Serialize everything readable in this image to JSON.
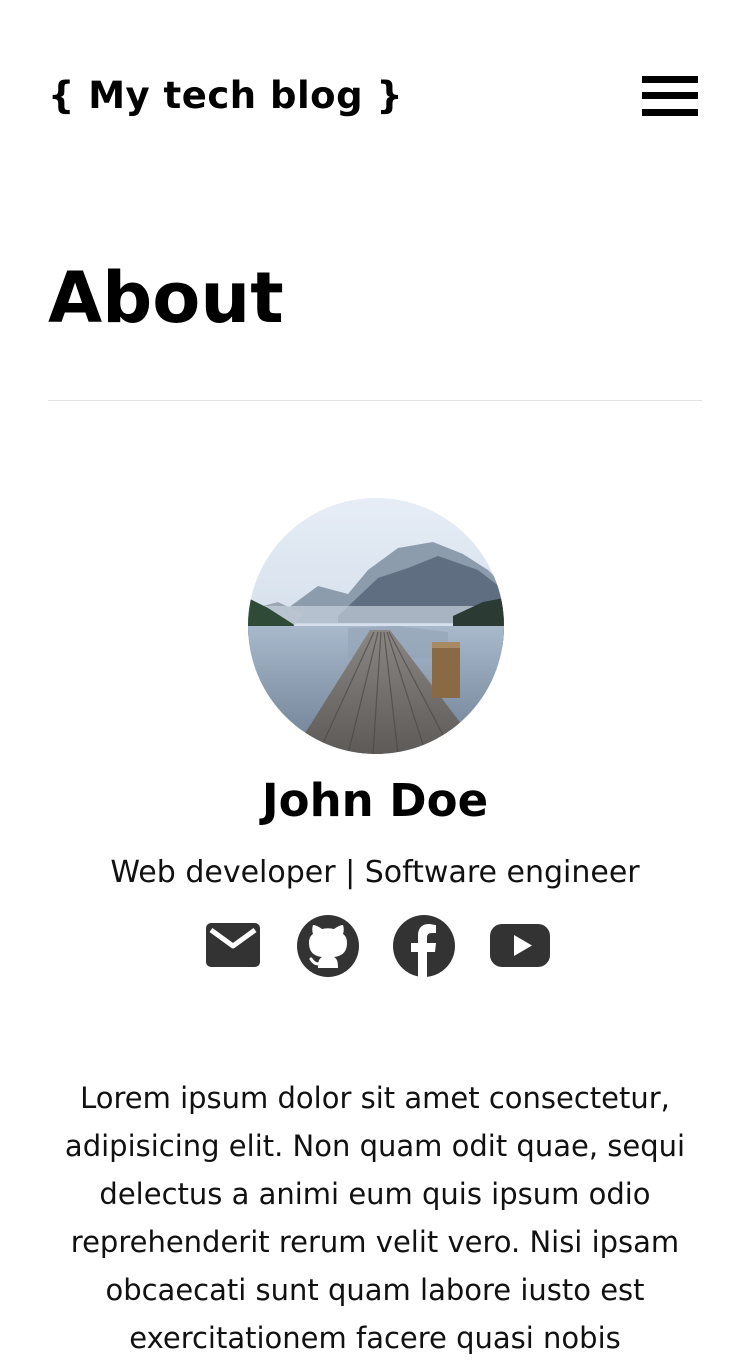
{
  "header": {
    "site_title": "{ My tech blog }",
    "menu_icon": "hamburger-menu-icon"
  },
  "page": {
    "title": "About"
  },
  "profile": {
    "avatar_alt": "Wooden pier on a mountain lake",
    "name": "John Doe",
    "role": "Web developer | Software engineer",
    "social": [
      {
        "icon": "mail-icon"
      },
      {
        "icon": "github-icon"
      },
      {
        "icon": "facebook-icon"
      },
      {
        "icon": "youtube-icon"
      }
    ],
    "icon_color": "#333333"
  },
  "bio": {
    "text": "Lorem ipsum dolor sit amet consectetur, adipisicing elit. Non quam odit quae, sequi delectus a animi eum quis ipsum odio reprehenderit rerum velit vero. Nisi ipsam obcaecati sunt quam labore iusto est exercitationem facere quasi nobis"
  }
}
